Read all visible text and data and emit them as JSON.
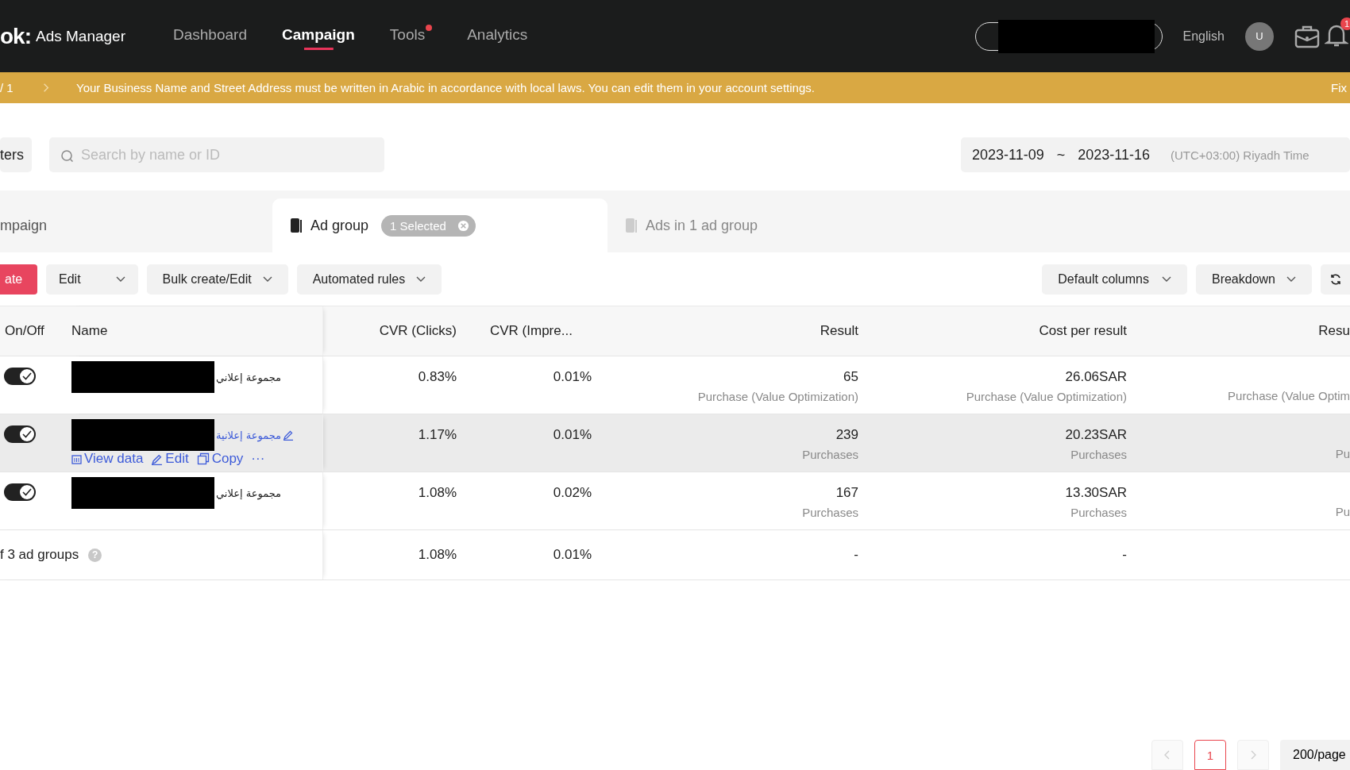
{
  "top_bar": {
    "logo": "ok:",
    "app_name": "Ads Manager",
    "nav": [
      {
        "label": "Dashboard",
        "selected": false,
        "dot": false
      },
      {
        "label": "Campaign",
        "selected": true,
        "dot": false
      },
      {
        "label": "Tools",
        "selected": false,
        "dot": true
      },
      {
        "label": "Analytics",
        "selected": false,
        "dot": false
      }
    ],
    "language": "English",
    "avatar": "U",
    "notification_badge": "1"
  },
  "banner": {
    "pager": "/ 1",
    "message": "Your Business Name and Street Address must be written in Arabic in accordance with local laws. You can edit them in your account settings.",
    "action": "Fix"
  },
  "filters": {
    "filters_button": "ters",
    "search": {
      "placeholder": "Search by name or ID"
    },
    "date_start": "2023-11-09",
    "date_separator": "~",
    "date_end": "2023-11-16",
    "timezone": "(UTC+03:00) Riyadh Time"
  },
  "level_tabs": [
    {
      "label": "mpaign",
      "selected": false
    },
    {
      "label": "Ad group",
      "selected": true,
      "chip": "1 Selected"
    },
    {
      "label": "Ads in 1 ad group",
      "selected": false
    }
  ],
  "toolbar": {
    "create": "ate",
    "menus": [
      "Edit",
      "Bulk create/Edit",
      "Automated rules"
    ],
    "right_menus": [
      "Default columns",
      "Breakdown"
    ]
  },
  "table": {
    "columns": [
      "On/Off",
      "Name",
      "CVR (Clicks)",
      "CVR (Impre...",
      "Result",
      "Cost per result",
      "Resu"
    ],
    "rows": [
      {
        "on": true,
        "selected": false,
        "name": "مجموعة إعلاني",
        "cvr_clicks": "0.83%",
        "cvr_impressions": "0.01%",
        "result": "65",
        "result_type": "Purchase (Value Optimization)",
        "cost": "26.06SAR",
        "cost_type": "Purchase (Value Optimization)",
        "column_7_type": "Purchase (Value Optim"
      },
      {
        "on": true,
        "selected": true,
        "name": "مجموعة إعلانية",
        "actions": [
          "View data",
          "Edit",
          "Copy",
          "···"
        ],
        "cvr_clicks": "1.17%",
        "cvr_impressions": "0.01%",
        "result": "239",
        "result_type": "Purchases",
        "cost": "20.23SAR",
        "cost_type": "Purchases",
        "column_7_type": "Pu"
      },
      {
        "on": true,
        "selected": false,
        "name": "مجموعة إعلاني",
        "cvr_clicks": "1.08%",
        "cvr_impressions": "0.02%",
        "result": "167",
        "result_type": "Purchases",
        "cost": "13.30SAR",
        "cost_type": "Purchases",
        "column_7_type": "Pu"
      }
    ],
    "total": {
      "label": "f 3 ad groups",
      "help": "?",
      "cvr_clicks": "1.08%",
      "cvr_impressions": "0.01%",
      "result": "-",
      "cost": "-"
    }
  },
  "pagination": {
    "pages": [
      {
        "label": "1",
        "selected": true
      }
    ],
    "page_size": "200/page"
  }
}
